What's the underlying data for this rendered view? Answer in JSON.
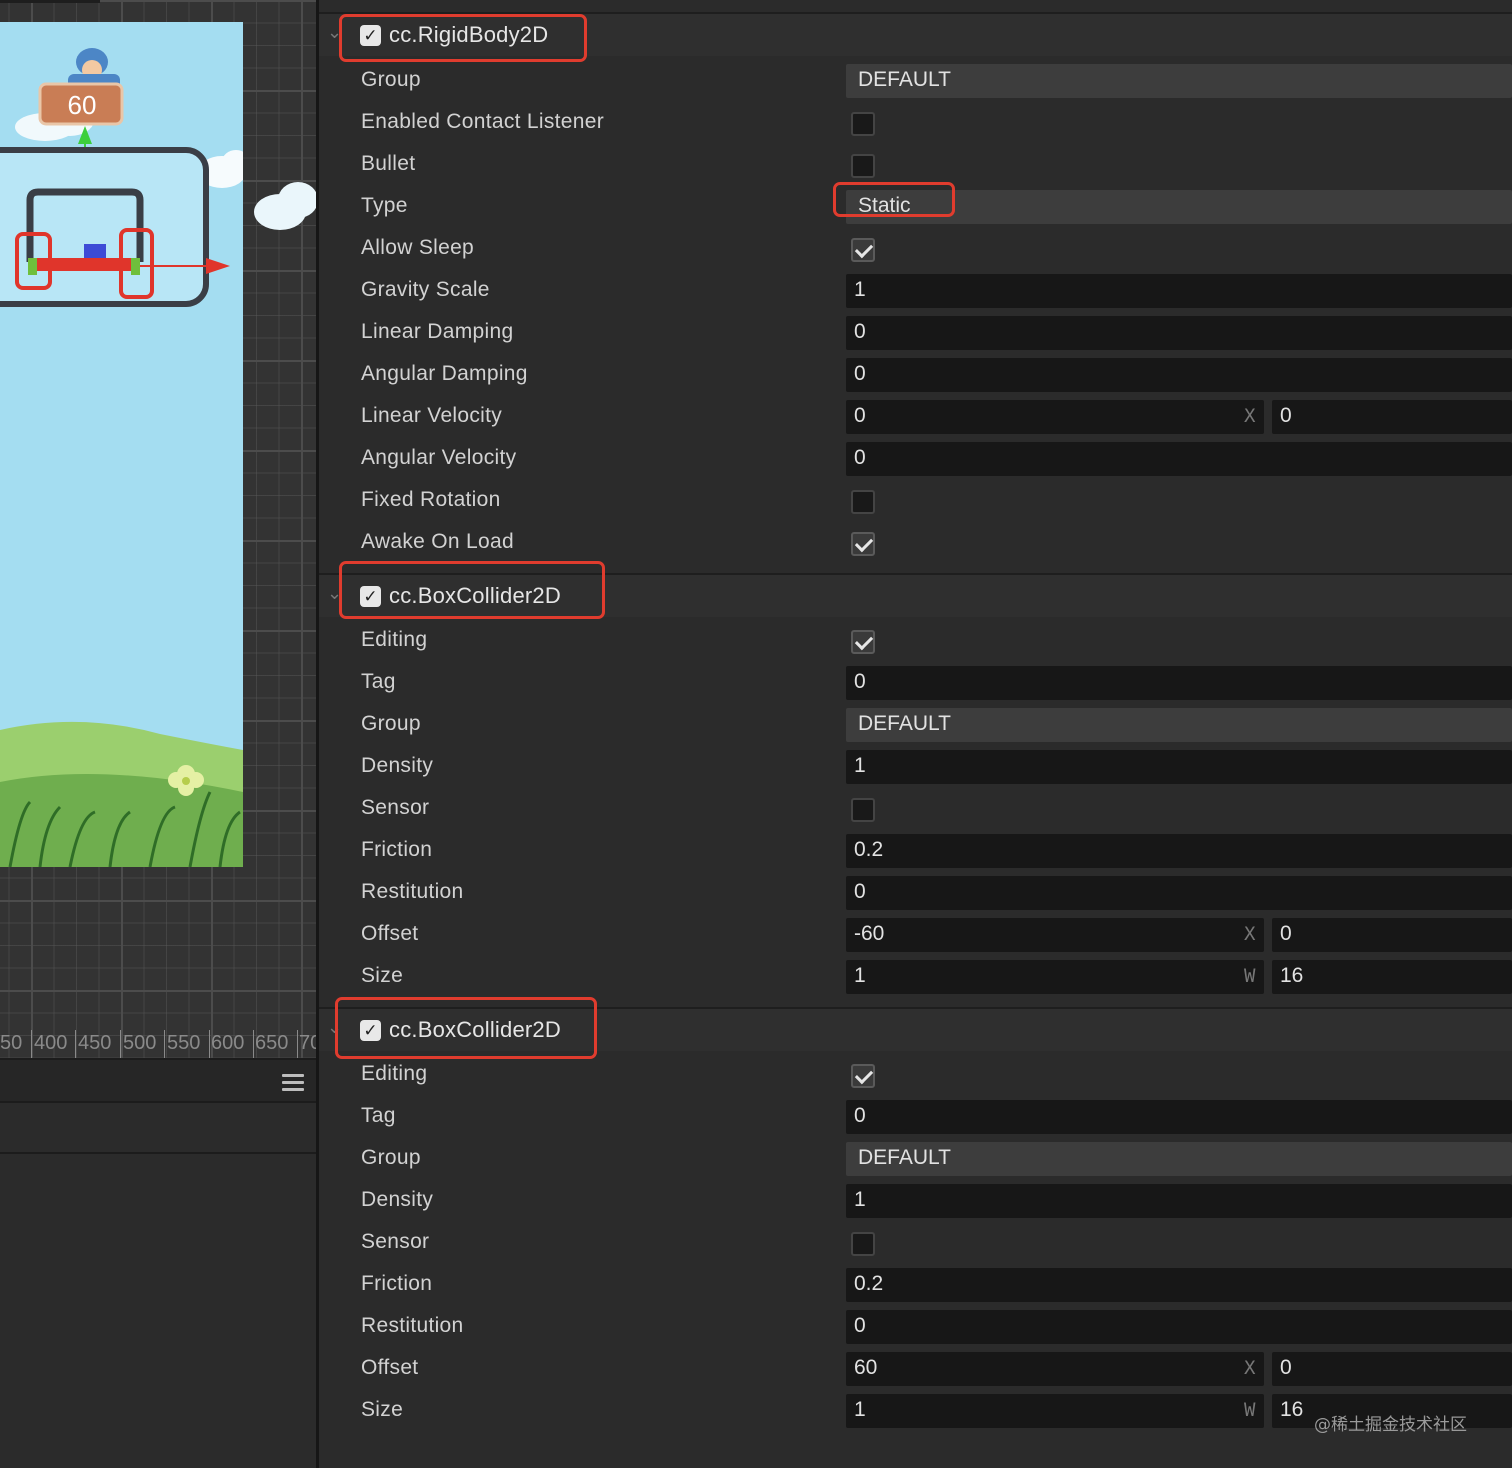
{
  "scene": {
    "score_label": "60",
    "ruler_labels": [
      "50",
      "400",
      "450",
      "500",
      "550",
      "600",
      "650",
      "70"
    ]
  },
  "inspector": {
    "rigidbody": {
      "title": "cc.RigidBody2D",
      "enabled": true,
      "group_label": "Group",
      "group_value": "DEFAULT",
      "contact_label": "Enabled Contact Listener",
      "contact_checked": false,
      "bullet_label": "Bullet",
      "bullet_checked": false,
      "type_label": "Type",
      "type_value": "Static",
      "sleep_label": "Allow Sleep",
      "sleep_checked": true,
      "gravity_label": "Gravity Scale",
      "gravity_value": "1",
      "lin_damp_label": "Linear Damping",
      "lin_damp_value": "0",
      "ang_damp_label": "Angular Damping",
      "ang_damp_value": "0",
      "lin_vel_label": "Linear Velocity",
      "lin_vel_x": "0",
      "lin_vel_axis": "X",
      "lin_vel_y": "0",
      "ang_vel_label": "Angular Velocity",
      "ang_vel_value": "0",
      "fixed_rot_label": "Fixed Rotation",
      "fixed_rot_checked": false,
      "awake_label": "Awake On Load",
      "awake_checked": true
    },
    "collider1": {
      "title": "cc.BoxCollider2D",
      "enabled": true,
      "editing_label": "Editing",
      "editing_checked": true,
      "tag_label": "Tag",
      "tag_value": "0",
      "group_label": "Group",
      "group_value": "DEFAULT",
      "density_label": "Density",
      "density_value": "1",
      "sensor_label": "Sensor",
      "sensor_checked": false,
      "friction_label": "Friction",
      "friction_value": "0.2",
      "restitution_label": "Restitution",
      "restitution_value": "0",
      "offset_label": "Offset",
      "offset_x": "-60",
      "offset_axis": "X",
      "offset_y": "0",
      "size_label": "Size",
      "size_a": "1",
      "size_axis": "W",
      "size_b": "16"
    },
    "collider2": {
      "title": "cc.BoxCollider2D",
      "enabled": true,
      "editing_label": "Editing",
      "editing_checked": true,
      "tag_label": "Tag",
      "tag_value": "0",
      "group_label": "Group",
      "group_value": "DEFAULT",
      "density_label": "Density",
      "density_value": "1",
      "sensor_label": "Sensor",
      "sensor_checked": false,
      "friction_label": "Friction",
      "friction_value": "0.2",
      "restitution_label": "Restitution",
      "restitution_value": "0",
      "offset_label": "Offset",
      "offset_x": "60",
      "offset_axis": "X",
      "offset_y": "0",
      "size_label": "Size",
      "size_a": "1",
      "size_axis": "W",
      "size_b": "16"
    }
  },
  "watermark": "@稀土掘金技术社区",
  "colors": {
    "highlight": "#e03c2e",
    "panel": "#2b2b2b",
    "field": "#171717",
    "sky": "#a4ddf1",
    "grass": "#6fae4e"
  }
}
